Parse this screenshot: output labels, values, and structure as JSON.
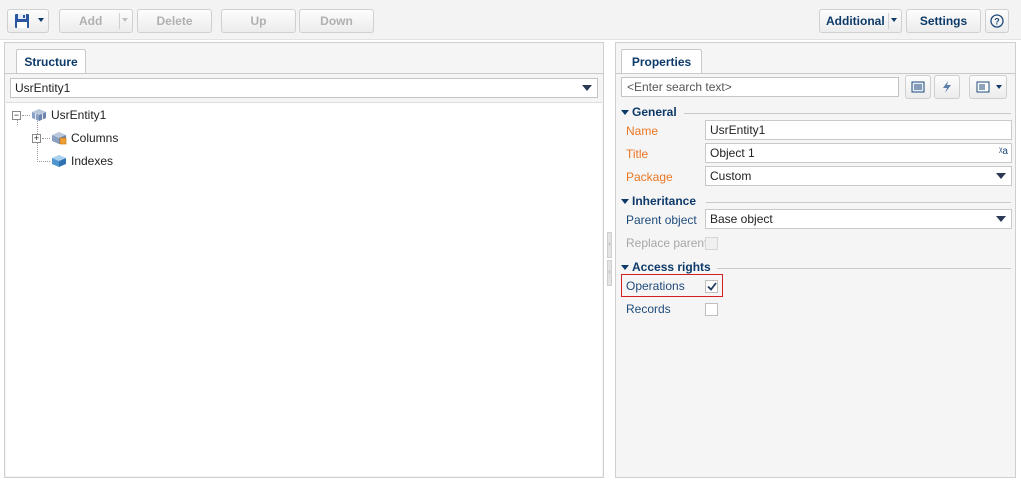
{
  "toolbar": {
    "add_label": "Add",
    "delete_label": "Delete",
    "up_label": "Up",
    "down_label": "Down",
    "additional_label": "Additional",
    "settings_label": "Settings",
    "save_icon": "floppy-disk-icon",
    "help_icon": "question-circle-icon"
  },
  "structure": {
    "tab_label": "Structure",
    "selector_value": "UsrEntity1",
    "tree": {
      "root_label": "UsrEntity1",
      "columns_label": "Columns",
      "indexes_label": "Indexes"
    }
  },
  "properties": {
    "tab_label": "Properties",
    "search_placeholder": "<Enter search text>",
    "sections": {
      "general": "General",
      "inheritance": "Inheritance",
      "access_rights": "Access rights"
    },
    "labels": {
      "name": "Name",
      "title": "Title",
      "package": "Package",
      "parent_object": "Parent object",
      "replace_parent": "Replace parent",
      "operations": "Operations",
      "records": "Records"
    },
    "values": {
      "name": "UsrEntity1",
      "title": "Object 1",
      "package": "Custom",
      "parent_object": "Base object",
      "replace_parent_checked": false,
      "operations_checked": true,
      "records_checked": false
    },
    "translate_icon_text": "ᵡa"
  },
  "colors": {
    "accent": "#0d3a69",
    "required_label": "#ea7623",
    "highlight_border": "#d22020"
  }
}
